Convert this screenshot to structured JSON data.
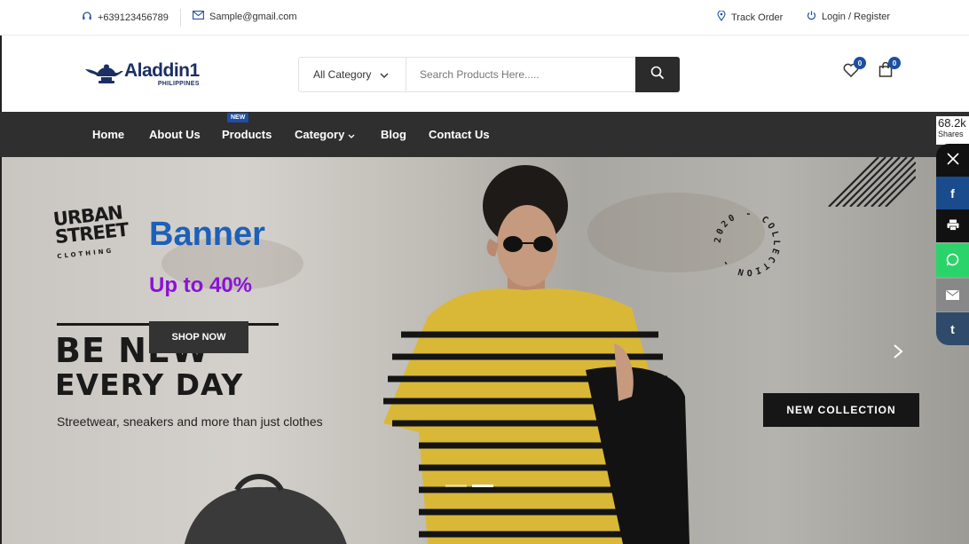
{
  "topbar": {
    "phone": "+639123456789",
    "email": "Sample@gmail.com",
    "track_order": "Track Order",
    "login_register": "Login / Register"
  },
  "logo": {
    "name": "Aladdin1",
    "sub": "PHILIPPINES"
  },
  "search": {
    "category_label": "All Category",
    "placeholder": "Search Products Here.....",
    "value": ""
  },
  "header_icons": {
    "wishlist_count": "0",
    "cart_count": "0"
  },
  "nav": {
    "items": [
      {
        "label": "Home"
      },
      {
        "label": "About Us"
      },
      {
        "label": "Products"
      },
      {
        "label": "Category"
      },
      {
        "label": "Blog"
      },
      {
        "label": "Contact Us"
      }
    ],
    "new_tag": "NEW"
  },
  "hero": {
    "brand_line1": "URBAN",
    "brand_line2": "STREET",
    "brand_line3": "CLOTHING",
    "title": "Banner",
    "promo": "Up to 40%",
    "shop_button": "SHOP NOW",
    "headline1": "BE NEW",
    "headline2": "EVERY DAY",
    "tagline": "Streetwear, sneakers and more than just clothes",
    "collection_button": "NEW COLLECTION",
    "badge_text": "2020 - COLLECTION -",
    "slides": 2,
    "active_slide": 2
  },
  "share": {
    "count": "68.2k",
    "label": "Shares",
    "buttons": [
      {
        "name": "twitter",
        "color": "#111111"
      },
      {
        "name": "facebook",
        "color": "#1a4b8c"
      },
      {
        "name": "print",
        "color": "#111111"
      },
      {
        "name": "whatsapp",
        "color": "#2bd46a"
      },
      {
        "name": "email",
        "color": "#888888"
      },
      {
        "name": "tumblr",
        "color": "#2f4a6b"
      }
    ]
  },
  "colors": {
    "accent": "#1d4fa3",
    "nav_bg": "#2f2f2f",
    "banner_title": "#1d60b8",
    "promo": "#8a12d8"
  }
}
